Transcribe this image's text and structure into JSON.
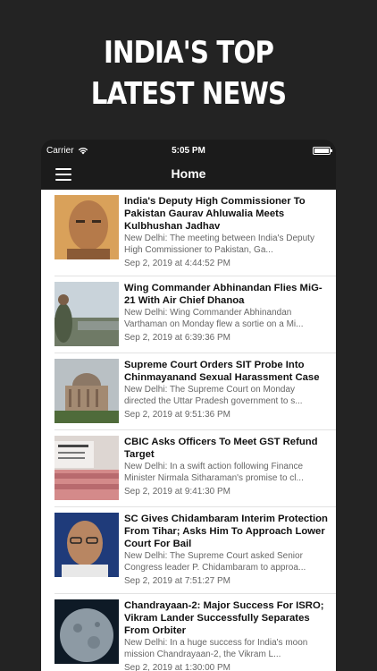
{
  "promo": {
    "line1": "INDIA'S TOP",
    "line2": "LATEST NEWS"
  },
  "status": {
    "carrier": "Carrier",
    "time": "5:05 PM"
  },
  "navbar": {
    "title": "Home"
  },
  "articles": [
    {
      "title": "India's Deputy High Commissioner To Pakistan Gaurav Ahluwalia Meets Kulbhushan Jadhav",
      "summary": "New Delhi: The meeting between India's Deputy High Commissioner to Pakistan, Ga...",
      "date": "Sep 2, 2019 at 4:44:52 PM"
    },
    {
      "title": "Wing Commander Abhinandan Flies MiG-21 With Air Chief Dhanoa",
      "summary": "New Delhi: Wing Commander Abhinandan Varthaman on Monday flew a sortie on a Mi...",
      "date": "Sep 2, 2019 at 6:39:36 PM"
    },
    {
      "title": "Supreme Court Orders SIT Probe Into Chinmayanand Sexual Harassment Case",
      "summary": "New Delhi: The Supreme Court on Monday directed the Uttar Pradesh government to s...",
      "date": "Sep 2, 2019 at 9:51:36 PM"
    },
    {
      "title": "CBIC Asks Officers To Meet GST Refund Target",
      "summary": "New Delhi: In a swift action following Finance Minister Nirmala Sitharaman's promise to cl...",
      "date": "Sep 2, 2019 at 9:41:30 PM"
    },
    {
      "title": "SC Gives Chidambaram Interim Protection From Tihar; Asks Him To Approach Lower Court For Bail",
      "summary": "New Delhi: The Supreme Court asked Senior Congress leader P. Chidambaram to approa...",
      "date": "Sep 2, 2019 at 7:51:27 PM"
    },
    {
      "title": "Chandrayaan-2: Major Success For ISRO; Vikram Lander Successfully Separates From Orbiter",
      "summary": "New Delhi: In a huge success for India's moon mission Chandrayaan-2, the Vikram L...",
      "date": "Sep 2, 2019 at 1:30:00 PM"
    }
  ]
}
